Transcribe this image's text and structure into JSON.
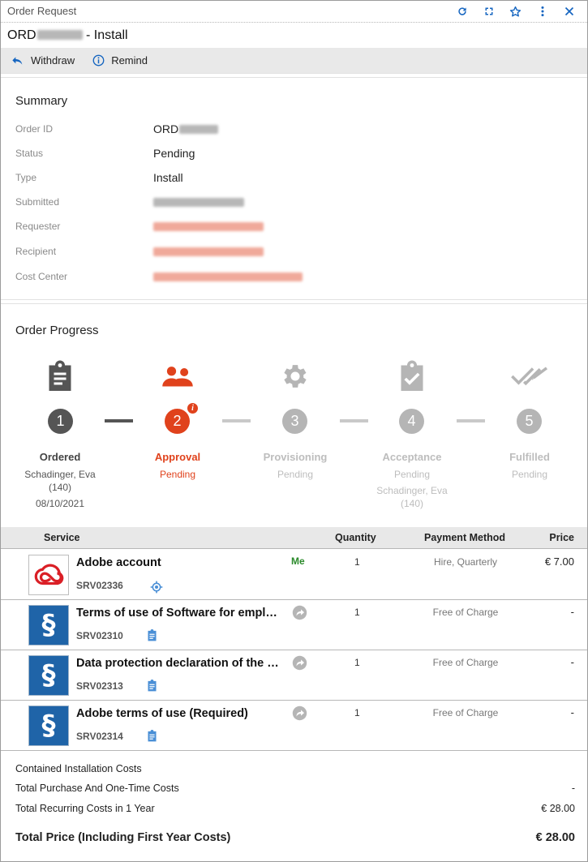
{
  "window": {
    "title": "Order Request",
    "icons": [
      "refresh-icon",
      "expand-icon",
      "star-icon",
      "more-vertical-icon",
      "close-icon"
    ]
  },
  "heading": {
    "prefix": "ORD",
    "suffix": " - Install"
  },
  "toolbar": {
    "withdraw_label": "Withdraw",
    "remind_label": "Remind"
  },
  "summary": {
    "title": "Summary",
    "fields": {
      "order_id": {
        "label": "Order ID",
        "value_prefix": "ORD"
      },
      "status": {
        "label": "Status",
        "value": "Pending"
      },
      "type": {
        "label": "Type",
        "value": "Install"
      },
      "submitted": {
        "label": "Submitted"
      },
      "requester": {
        "label": "Requester"
      },
      "recipient": {
        "label": "Recipient"
      },
      "cost_center": {
        "label": "Cost Center"
      }
    }
  },
  "progress": {
    "title": "Order Progress",
    "colors": {
      "done": "#555555",
      "active": "#e0421c",
      "future": "#b5b5b5"
    },
    "stages": [
      {
        "number": "1",
        "name": "Ordered",
        "state": "done",
        "line1": "Schadinger, Eva",
        "line2": "(140)",
        "line3": "08/10/2021",
        "icon": "clipboard-list-icon"
      },
      {
        "number": "2",
        "name": "Approval",
        "state": "active",
        "line1": "Pending",
        "badge": "i",
        "icon": "people-icon"
      },
      {
        "number": "3",
        "name": "Provisioning",
        "state": "future",
        "line1": "Pending",
        "icon": "gear-icon"
      },
      {
        "number": "4",
        "name": "Acceptance",
        "state": "future",
        "line1": "Pending",
        "line2": "Schadinger, Eva",
        "line3": "(140)",
        "icon": "clipboard-check-icon"
      },
      {
        "number": "5",
        "name": "Fulfilled",
        "state": "future",
        "line1": "Pending",
        "icon": "double-check-icon"
      }
    ]
  },
  "table": {
    "headers": {
      "service": "Service",
      "quantity": "Quantity",
      "payment": "Payment Method",
      "price": "Price"
    },
    "rows": [
      {
        "name": "Adobe account",
        "code": "SRV02336",
        "tag": "Me",
        "quantity": "1",
        "payment": "Hire, Quarterly",
        "price": "€ 7.00",
        "logo": "adobe-creative-cloud-icon",
        "code_icon": "target-icon"
      },
      {
        "name": "Terms of use of Software for employees",
        "code": "SRV02310",
        "quantity": "1",
        "payment": "Free of Charge",
        "price": "-",
        "logo": "paragraph-icon",
        "code_icon": "clipboard-icon"
      },
      {
        "name": "Data protection declaration of the University",
        "code": "SRV02313",
        "quantity": "1",
        "payment": "Free of Charge",
        "price": "-",
        "logo": "paragraph-icon",
        "code_icon": "clipboard-icon"
      },
      {
        "name": "Adobe terms of use (Required)",
        "code": "SRV02314",
        "quantity": "1",
        "payment": "Free of Charge",
        "price": "-",
        "logo": "paragraph-icon",
        "code_icon": "clipboard-icon"
      }
    ]
  },
  "totals": {
    "installation": {
      "label": "Contained Installation Costs",
      "value": ""
    },
    "purchase": {
      "label": "Total Purchase And One-Time Costs",
      "value": "-"
    },
    "recurring": {
      "label": "Total Recurring Costs in 1 Year",
      "value": "€ 28.00"
    },
    "total": {
      "label": "Total Price (Including First Year Costs)",
      "value": "€ 28.00"
    }
  }
}
